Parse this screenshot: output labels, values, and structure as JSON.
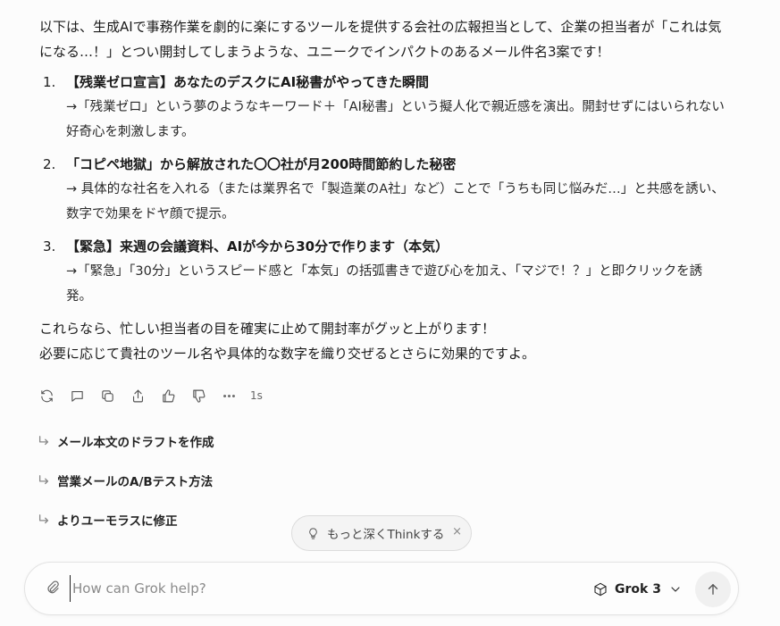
{
  "message": {
    "intro": "以下は、生成AIで事務作業を劇的に楽にするツールを提供する会社の広報担当として、企業の担当者が「これは気になる…！」とつい開封してしまうような、ユニークでインパクトのあるメール件名3案です！",
    "options": [
      {
        "num": "1.",
        "title": "【残業ゼロ宣言】あなたのデスクにAI秘書がやってきた瞬間",
        "desc": "→「残業ゼロ」という夢のようなキーワード＋「AI秘書」という擬人化で親近感を演出。開封せずにはいられない好奇心を刺激します。"
      },
      {
        "num": "2.",
        "title": "「コピペ地獄」から解放された〇〇社が月200時間節約した秘密",
        "desc": "→ 具体的な社名を入れる（または業界名で「製造業のA社」など）ことで「うちも同じ悩みだ…」と共感を誘い、数字で効果をドヤ顔で提示。"
      },
      {
        "num": "3.",
        "title": "【緊急】来週の会議資料、AIが今から30分で作ります（本気）",
        "desc": "→「緊急」「30分」というスピード感と「本気」の括弧書きで遊び心を加え、「マジで！？」と即クリックを誘発。"
      }
    ],
    "closing_1": "これらなら、忙しい担当者の目を確実に止めて開封率がグッと上がります！",
    "closing_2": "必要に応じて貴社のツール名や具体的な数字を織り交ぜるとさらに効果的ですよ。"
  },
  "actions": {
    "icons": [
      "regenerate-icon",
      "comment-icon",
      "copy-icon",
      "share-icon",
      "thumbs-up-icon",
      "thumbs-down-icon",
      "more-icon"
    ],
    "time": "1s"
  },
  "suggestions": [
    "メール本文のドラフトを作成",
    "営業メールのA/Bテスト方法",
    "よりユーモラスに修正"
  ],
  "think_chip": {
    "label": "もっと深くThinkする",
    "close": "×"
  },
  "composer": {
    "placeholder": "How can Grok help?",
    "value": "",
    "model": "Grok 3"
  }
}
